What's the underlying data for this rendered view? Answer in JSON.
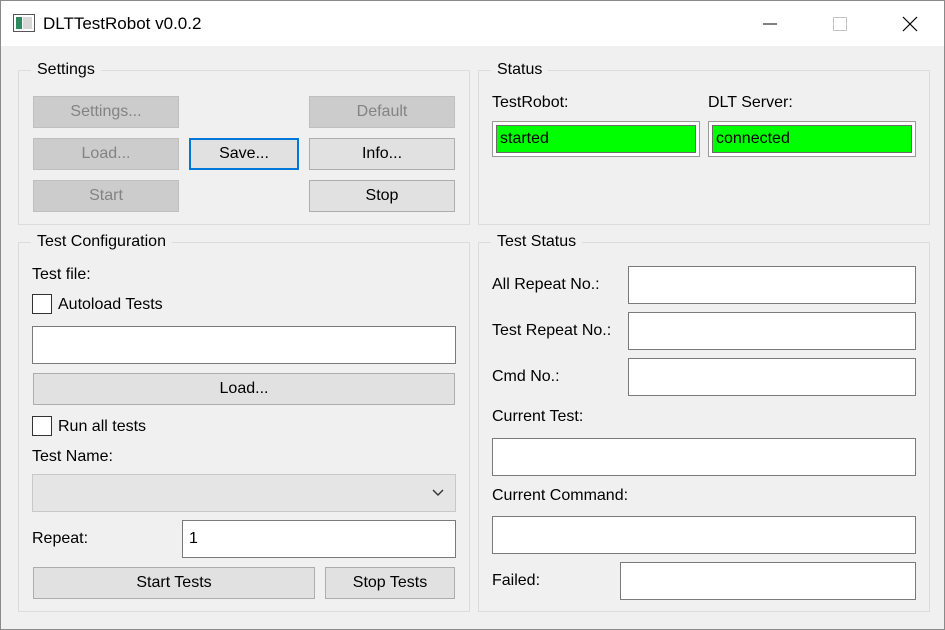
{
  "window": {
    "title": "DLTTestRobot v0.0.2",
    "controls": [
      "minimize-icon",
      "maximize-icon",
      "close-icon"
    ]
  },
  "settings": {
    "title": "Settings",
    "buttons": {
      "settings": "Settings...",
      "default": "Default",
      "load": "Load...",
      "save": "Save...",
      "info": "Info...",
      "start": "Start",
      "stop": "Stop"
    }
  },
  "status": {
    "title": "Status",
    "testrobot_label": "TestRobot:",
    "testrobot_value": "started",
    "dltserver_label": "DLT Server:",
    "dltserver_value": "connected",
    "ok_color": "#00ff00"
  },
  "test_config": {
    "title": "Test Configuration",
    "test_file_label": "Test file:",
    "autoload_label": "Autoload Tests",
    "autoload_checked": false,
    "test_file_value": "",
    "load_button": "Load...",
    "run_all_label": "Run all tests",
    "run_all_checked": false,
    "test_name_label": "Test Name:",
    "test_name_value": "",
    "repeat_label": "Repeat:",
    "repeat_value": "1",
    "start_tests_button": "Start Tests",
    "stop_tests_button": "Stop Tests"
  },
  "test_status": {
    "title": "Test Status",
    "all_repeat_label": "All Repeat No.:",
    "all_repeat_value": "",
    "test_repeat_label": "Test Repeat No.:",
    "test_repeat_value": "",
    "cmd_no_label": "Cmd No.:",
    "cmd_no_value": "",
    "current_test_label": "Current Test:",
    "current_test_value": "",
    "current_command_label": "Current Command:",
    "current_command_value": "",
    "failed_label": "Failed:",
    "failed_value": ""
  },
  "colors": {
    "accent": "#0078d7",
    "window_bg": "#f0f0f0"
  }
}
